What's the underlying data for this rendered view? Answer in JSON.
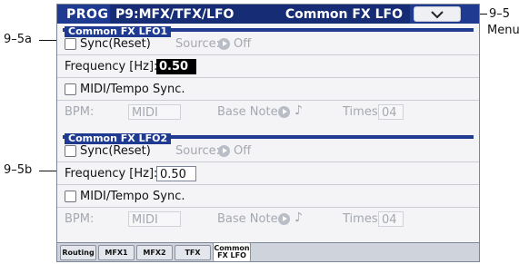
{
  "header": {
    "mode": "PROG",
    "page_path": "P9:MFX/TFX/LFO",
    "page_name": "Common FX LFO"
  },
  "callouts": {
    "menu_number": "9–5",
    "menu_label": "Menu",
    "lfo1": "9–5a",
    "lfo2": "9–5b"
  },
  "lfo1": {
    "title": "Common FX LFO1",
    "sync_label": "Sync(Reset)",
    "sync_checked": false,
    "source_label": "Source:",
    "source_value": "Off",
    "frequency_label": "Frequency [Hz]:",
    "frequency_value": "0.50",
    "midi_tempo_label": "MIDI/Tempo Sync.",
    "midi_tempo_checked": false,
    "bpm_label": "BPM:",
    "bpm_value": "MIDI",
    "base_note_label": "Base Note:",
    "base_note_value": "♪",
    "times_label": "Times:",
    "times_value": "04"
  },
  "lfo2": {
    "title": "Common FX LFO2",
    "sync_label": "Sync(Reset)",
    "sync_checked": false,
    "source_label": "Source:",
    "source_value": "Off",
    "frequency_label": "Frequency [Hz]:",
    "frequency_value": "0.50",
    "midi_tempo_label": "MIDI/Tempo Sync.",
    "midi_tempo_checked": false,
    "bpm_label": "BPM:",
    "bpm_value": "MIDI",
    "base_note_label": "Base Note:",
    "base_note_value": "♪",
    "times_label": "Times:",
    "times_value": "04"
  },
  "tabs": [
    {
      "label": "Routing",
      "active": false
    },
    {
      "label": "MFX1",
      "active": false
    },
    {
      "label": "MFX2",
      "active": false
    },
    {
      "label": "TFX",
      "active": false
    },
    {
      "label_line1": "Common",
      "label_line2": "FX LFO",
      "active": true
    }
  ]
}
